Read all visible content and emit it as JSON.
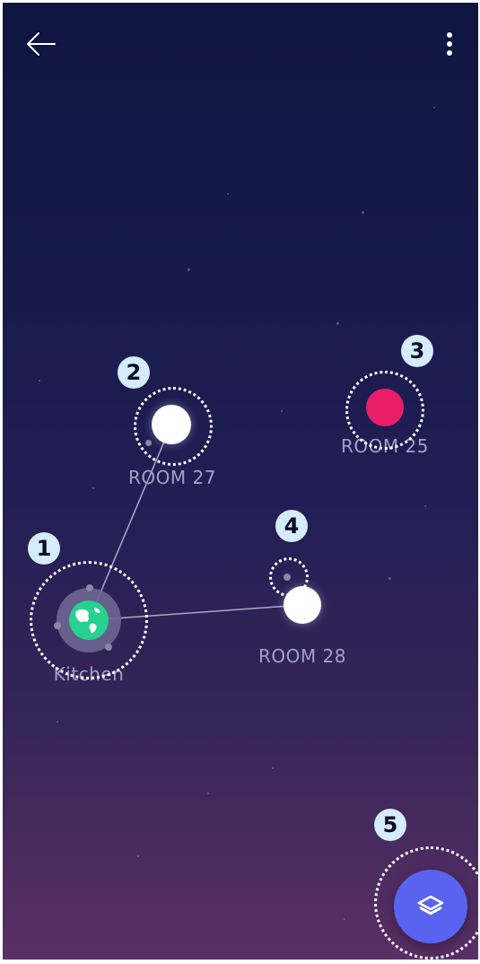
{
  "rooms": {
    "kitchen": {
      "label": "Kitchen",
      "color": "#27d18f"
    },
    "room27": {
      "label": "ROOM 27",
      "color": "#ffffff"
    },
    "room25": {
      "label": "ROOM 25",
      "color": "#e91e69"
    },
    "room28": {
      "label": "ROOM 28",
      "color": "#ffffff"
    }
  },
  "badges": [
    "1",
    "2",
    "3",
    "4",
    "5"
  ],
  "colors": {
    "accent": "#5a63f0",
    "badge_bg": "#d4ecfb",
    "label": "#9fa2c2"
  },
  "icons": {
    "back": "back-arrow-icon",
    "menu": "more-vertical-icon",
    "fab": "layers-icon",
    "kitchen": "globe-icon"
  }
}
